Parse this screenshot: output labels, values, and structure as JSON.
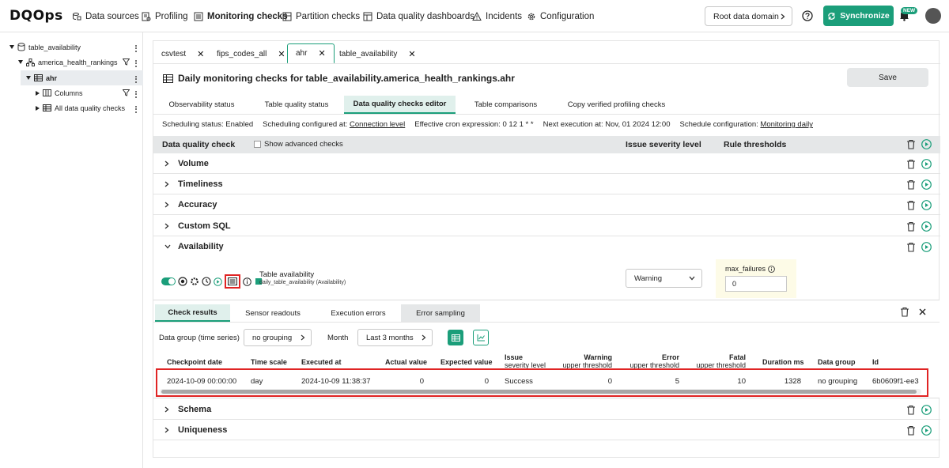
{
  "app": {
    "logo": "DQOps",
    "nav": [
      "Data sources",
      "Profiling",
      "Monitoring checks",
      "Partition checks",
      "Data quality dashboards",
      "Incidents",
      "Configuration"
    ],
    "root_domain": "Root data domain",
    "sync_label": "Synchronize",
    "new_badge": "NEW"
  },
  "tree": {
    "table": "table_availability",
    "schema": "america_health_rankings",
    "selected": "ahr",
    "columns": "Columns",
    "all_checks": "All data quality checks"
  },
  "tabs": [
    "csvtest",
    "fips_codes_all",
    "ahr",
    "table_availability"
  ],
  "page": {
    "title": "Daily monitoring checks for table_availability.america_health_rankings.ahr",
    "save": "Save",
    "subtabs": [
      "Observability status",
      "Table quality status",
      "Data quality checks editor",
      "Table comparisons",
      "Copy verified profiling checks"
    ]
  },
  "schedule": {
    "status": "Scheduling status: Enabled",
    "configured_prefix": "Scheduling configured at: ",
    "configured_link": "Connection level",
    "cron": "Effective cron expression: 0 12 1 * *",
    "next": "Next execution at: Nov, 01 2024 12:00",
    "config_prefix": "Schedule configuration: ",
    "config_link": "Monitoring daily"
  },
  "header": {
    "check": "Data quality check",
    "advanced": "Show advanced checks",
    "severity": "Issue severity level",
    "thresholds": "Rule thresholds"
  },
  "categories": [
    "Volume",
    "Timeliness",
    "Accuracy",
    "Custom SQL",
    "Availability",
    "Schema",
    "Uniqueness"
  ],
  "check": {
    "name": "Table availability",
    "sub": "daily_table_availability (Availability)",
    "severity": "Warning",
    "rule_name": "max_failures",
    "rule_value": "0"
  },
  "results": {
    "tabs": [
      "Check results",
      "Sensor readouts",
      "Execution errors",
      "Error sampling"
    ],
    "group_label": "Data group (time series)",
    "group_value": "no grouping",
    "month_label": "Month",
    "month_value": "Last 3 months",
    "columns": [
      {
        "line1": "Checkpoint date",
        "line2": ""
      },
      {
        "line1": "Time scale",
        "line2": ""
      },
      {
        "line1": "Executed at",
        "line2": ""
      },
      {
        "line1": "Actual value",
        "line2": ""
      },
      {
        "line1": "Expected value",
        "line2": ""
      },
      {
        "line1": "Issue",
        "line2": "severity level"
      },
      {
        "line1": "Warning",
        "line2": "upper threshold"
      },
      {
        "line1": "Error",
        "line2": "upper threshold"
      },
      {
        "line1": "Fatal",
        "line2": "upper threshold"
      },
      {
        "line1": "Duration ms",
        "line2": ""
      },
      {
        "line1": "Data group",
        "line2": ""
      },
      {
        "line1": "Id",
        "line2": ""
      }
    ],
    "row": [
      "2024-10-09 00:00:00",
      "day",
      "2024-10-09 11:38:37",
      "0",
      "0",
      "Success",
      "0",
      "5",
      "10",
      "1328",
      "no grouping",
      "6b0609f1-ee3"
    ]
  }
}
